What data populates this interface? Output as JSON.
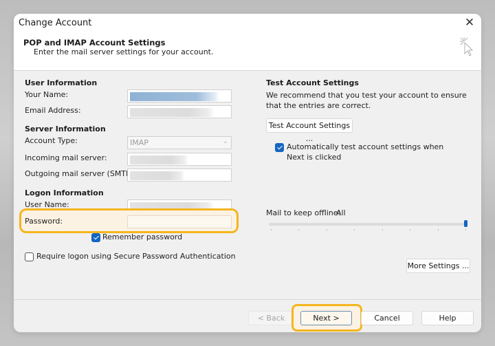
{
  "window": {
    "title": "Change Account",
    "close_icon": "close-icon"
  },
  "header": {
    "title": "POP and IMAP Account Settings",
    "subtitle": "Enter the mail server settings for your account.",
    "icon": "cursor-click-icon"
  },
  "user_info": {
    "section": "User Information",
    "your_name_label": "Your Name:",
    "email_label": "Email Address:",
    "your_name_value": "",
    "email_value": ""
  },
  "server_info": {
    "section": "Server Information",
    "account_type_label": "Account Type:",
    "account_type_value": "IMAP",
    "incoming_label": "Incoming mail server:",
    "outgoing_label": "Outgoing mail server (SMTP):"
  },
  "logon_info": {
    "section": "Logon Information",
    "username_label": "User Name:",
    "password_label": "Password:",
    "password_value": "",
    "remember_password_label": "Remember password",
    "remember_password_checked": true,
    "spa_label": "Require logon using Secure Password Authentication",
    "spa_checked": false
  },
  "test_settings": {
    "section": "Test Account Settings",
    "description": "We recommend that you test your account to ensure that the entries are correct.",
    "test_button": "Test Account Settings ...",
    "auto_test_label": "Automatically test account settings when Next is clicked",
    "auto_test_checked": true
  },
  "offline": {
    "label": "Mail to keep offline:",
    "value": "All",
    "slider_position_fraction": 1.0,
    "tick_count": 8
  },
  "buttons": {
    "more_settings": "More Settings ...",
    "back": "< Back",
    "next": "Next >",
    "cancel": "Cancel",
    "help": "Help"
  },
  "colors": {
    "accent": "#1465c0",
    "highlight": "#f5b51f"
  }
}
